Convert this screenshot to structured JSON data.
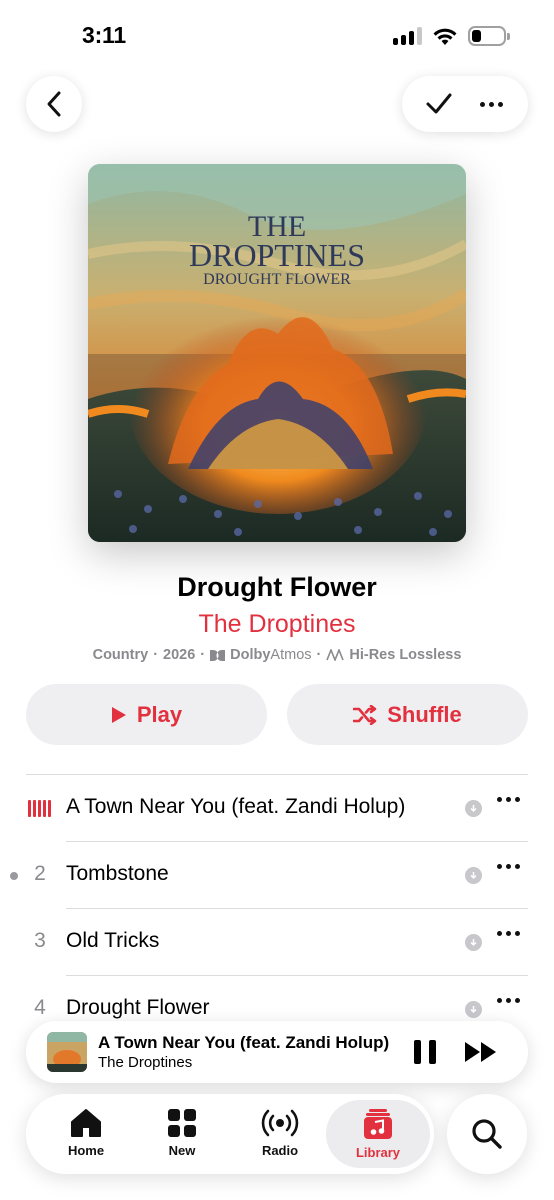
{
  "status_bar": {
    "time": "3:11"
  },
  "header": {
    "back_icon": "chevron-left-icon",
    "check_icon": "checkmark-icon",
    "more_icon": "ellipsis-icon"
  },
  "album": {
    "art_title_line1": "THE",
    "art_title_line2": "DROPTINES",
    "art_subtitle": "DROUGHT FLOWER",
    "title": "Drought Flower",
    "artist": "The Droptines",
    "genre": "Country",
    "year": "2026",
    "dolby_bold": "Dolby",
    "dolby_thin": "Atmos",
    "lossless": "Hi-Res Lossless",
    "separator": "·"
  },
  "actions": {
    "play_label": "Play",
    "shuffle_label": "Shuffle"
  },
  "tracks": [
    {
      "number": "",
      "title": "A Town Near You (feat. Zandi Holup)",
      "playing": true
    },
    {
      "number": "2",
      "title": "Tombstone",
      "playing": false
    },
    {
      "number": "3",
      "title": "Old Tricks",
      "playing": false
    },
    {
      "number": "4",
      "title": "Drought Flower",
      "playing": false
    }
  ],
  "mini_player": {
    "title": "A Town Near You (feat. Zandi Holup)",
    "artist": "The Droptines"
  },
  "tab_bar": {
    "tabs": [
      {
        "label": "Home",
        "icon": "house-icon"
      },
      {
        "label": "New",
        "icon": "grid-icon"
      },
      {
        "label": "Radio",
        "icon": "radio-waves-icon"
      },
      {
        "label": "Library",
        "icon": "music-library-icon"
      }
    ],
    "active": "Library",
    "search_icon": "search-icon"
  },
  "colors": {
    "accent": "#e3303e",
    "secondary_text": "#8a8a8e",
    "button_bg": "#efeff2"
  }
}
